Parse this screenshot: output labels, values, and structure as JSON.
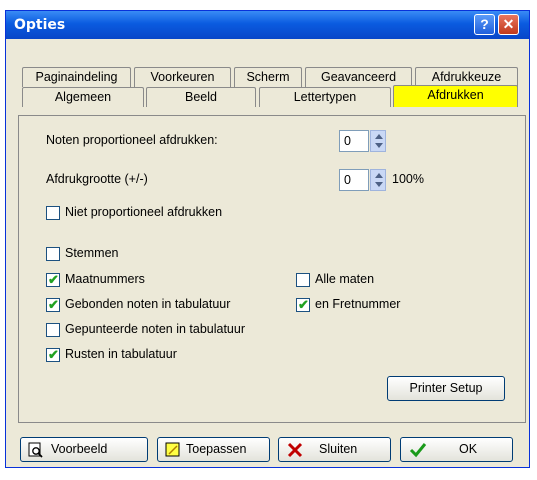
{
  "window": {
    "title": "Opties",
    "help_label": "?",
    "close_label": "✕"
  },
  "tabs_row1": [
    "Paginaindeling",
    "Voorkeuren",
    "Scherm",
    "Geavanceerd",
    "Afdrukkeuze"
  ],
  "tabs_row2": [
    "Algemeen",
    "Beeld",
    "Lettertypen",
    "Afdrukken"
  ],
  "active_tab": "Afdrukken",
  "fields": {
    "noten_label": "Noten proportioneel afdrukken:",
    "noten_value": "0",
    "grootte_label": "Afdrukgrootte (+/-)",
    "grootte_value": "0",
    "grootte_suffix": "100%"
  },
  "checkboxes": {
    "niet_proportioneel": {
      "label": "Niet proportioneel afdrukken",
      "checked": false
    },
    "stemmen": {
      "label": "Stemmen",
      "checked": false
    },
    "maatnummers": {
      "label": "Maatnummers",
      "checked": true
    },
    "alle_maten": {
      "label": "Alle maten",
      "checked": false
    },
    "gebonden": {
      "label": "Gebonden noten in tabulatuur",
      "checked": true
    },
    "fretnummer": {
      "label": "en Fretnummer",
      "checked": true
    },
    "gepunteerde": {
      "label": "Gepunteerde noten in tabulatuur",
      "checked": false
    },
    "rusten": {
      "label": "Rusten in tabulatuur",
      "checked": true
    }
  },
  "printer_setup_label": "Printer Setup",
  "buttons": {
    "voorbeeld": "Voorbeeld",
    "toepassen": "Toepassen",
    "sluiten": "Sluiten",
    "ok": "OK"
  }
}
